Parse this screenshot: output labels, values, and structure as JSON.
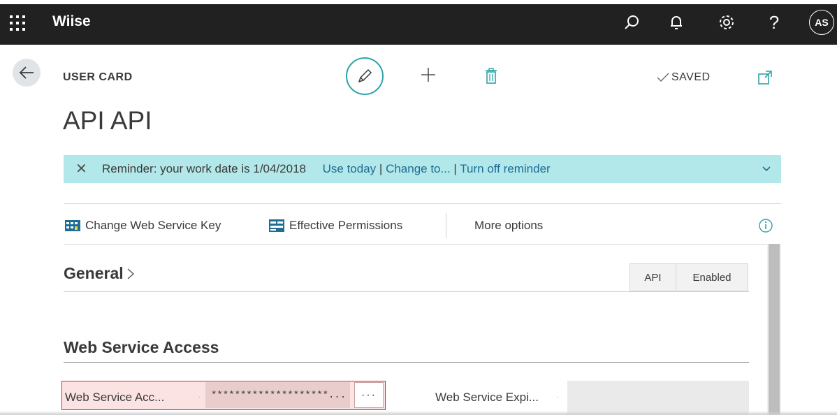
{
  "topbar": {
    "app_name": "Wiise",
    "avatar_initials": "AS",
    "help_label": "?",
    "icons": [
      "waffle-icon",
      "search-icon",
      "bell-icon",
      "gear-icon",
      "help-icon"
    ]
  },
  "page": {
    "caption": "USER CARD",
    "title": "API API",
    "saved_label": "SAVED"
  },
  "notification": {
    "text": "Reminder: your work date is 1/04/2018",
    "use_today": "Use today",
    "change_to": "Change to...",
    "turn_off": "Turn off reminder"
  },
  "actions": {
    "change_key": "Change Web Service Key",
    "effective_permissions": "Effective Permissions",
    "more_options": "More options"
  },
  "general": {
    "heading": "General",
    "chips": [
      "API",
      "Enabled"
    ]
  },
  "web_service_access": {
    "heading": "Web Service Access",
    "key_label": "Web Service Acc...",
    "key_value": "********************...",
    "lookup_label": "···",
    "expiry_label": "Web Service Expi...",
    "expiry_value": ""
  },
  "colors": {
    "topbar": "#212121",
    "accent": "#2fa3a8",
    "notification_bg": "#b3e8ea",
    "link": "#1d6d95",
    "error_border": "#d12e2e"
  }
}
